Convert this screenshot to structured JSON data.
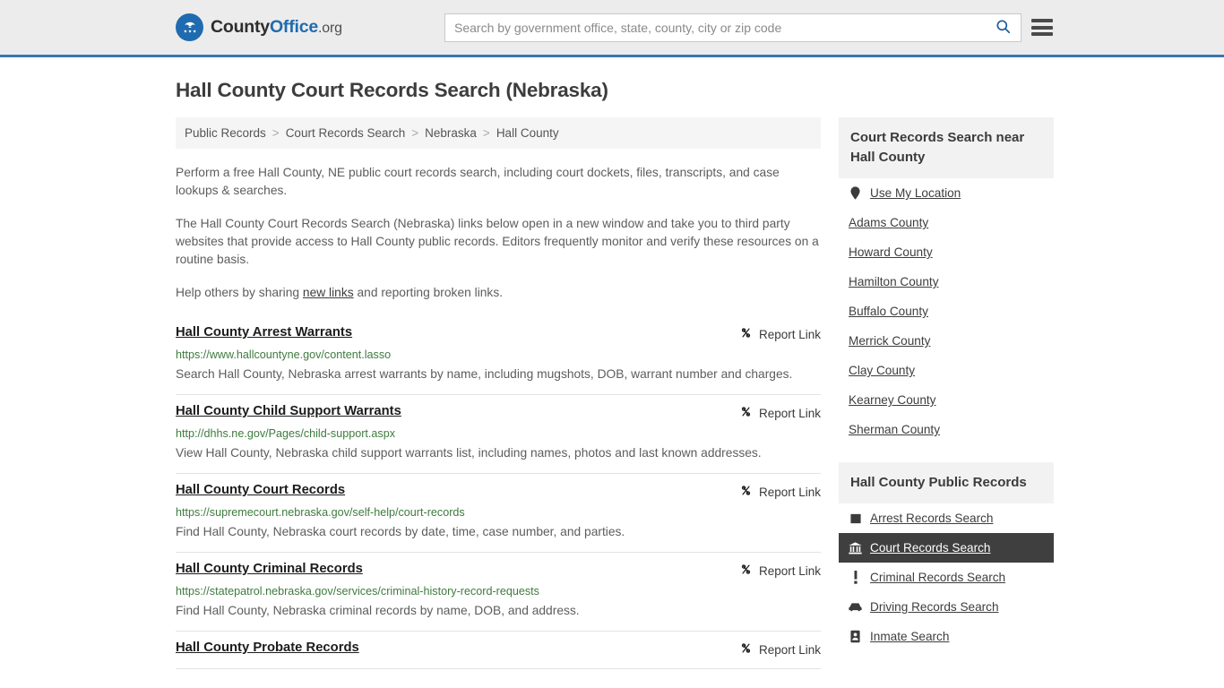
{
  "header": {
    "brand": {
      "part1": "County",
      "part2": "Office",
      "part3": ".org",
      "logo_icon": "eagle-shield-logo"
    },
    "search": {
      "placeholder": "Search by government office, state, county, city or zip code",
      "value": "",
      "search_icon": "search-icon"
    },
    "menu_icon": "hamburger-menu-icon",
    "accent_color": "#3a77ab",
    "background": "#ececec"
  },
  "page": {
    "title": "Hall County Court Records Search (Nebraska)"
  },
  "breadcrumb": {
    "separator": ">",
    "items": [
      {
        "label": "Public Records"
      },
      {
        "label": "Court Records Search"
      },
      {
        "label": "Nebraska"
      },
      {
        "label": "Hall County"
      }
    ]
  },
  "intro": {
    "p1": "Perform a free Hall County, NE public court records search, including court dockets, files, transcripts, and case lookups & searches.",
    "p2": "The Hall County Court Records Search (Nebraska) links below open in a new window and take you to third party websites that provide access to Hall County public records. Editors frequently monitor and verify these resources on a routine basis.",
    "p3_before": "Help others by sharing ",
    "p3_link": "new links",
    "p3_after": " and reporting broken links."
  },
  "results": {
    "report_label": "Report Link",
    "report_icon": "broken-link-icon",
    "items": [
      {
        "title": "Hall County Arrest Warrants",
        "url": "https://www.hallcountyne.gov/content.lasso",
        "description": "Search Hall County, Nebraska arrest warrants by name, including mugshots, DOB, warrant number and charges."
      },
      {
        "title": "Hall County Child Support Warrants",
        "url": "http://dhhs.ne.gov/Pages/child-support.aspx",
        "description": "View Hall County, Nebraska child support warrants list, including names, photos and last known addresses."
      },
      {
        "title": "Hall County Court Records",
        "url": "https://supremecourt.nebraska.gov/self-help/court-records",
        "description": "Find Hall County, Nebraska court records by date, time, case number, and parties."
      },
      {
        "title": "Hall County Criminal Records",
        "url": "https://statepatrol.nebraska.gov/services/criminal-history-record-requests",
        "description": "Find Hall County, Nebraska criminal records by name, DOB, and address."
      },
      {
        "title": "Hall County Probate Records",
        "url": "",
        "description": ""
      }
    ]
  },
  "sidebar": {
    "nearby": {
      "heading": "Court Records Search near Hall County",
      "items": [
        {
          "label": "Use My Location",
          "icon": "map-pin-icon"
        },
        {
          "label": "Adams County",
          "icon": ""
        },
        {
          "label": "Howard County",
          "icon": ""
        },
        {
          "label": "Hamilton County",
          "icon": ""
        },
        {
          "label": "Buffalo County",
          "icon": ""
        },
        {
          "label": "Merrick County",
          "icon": ""
        },
        {
          "label": "Clay County",
          "icon": ""
        },
        {
          "label": "Kearney County",
          "icon": ""
        },
        {
          "label": "Sherman County",
          "icon": ""
        }
      ]
    },
    "public_records": {
      "heading": "Hall County Public Records",
      "active_label": "Court Records Search",
      "active_color": "#3f3f3f",
      "items": [
        {
          "label": "Arrest Records Search",
          "icon": "square-icon",
          "active": false
        },
        {
          "label": "Court Records Search",
          "icon": "courthouse-icon",
          "active": true
        },
        {
          "label": "Criminal Records Search",
          "icon": "exclamation-icon",
          "active": false
        },
        {
          "label": "Driving Records Search",
          "icon": "car-icon",
          "active": false
        },
        {
          "label": "Inmate Search",
          "icon": "id-badge-icon",
          "active": false
        }
      ]
    }
  }
}
